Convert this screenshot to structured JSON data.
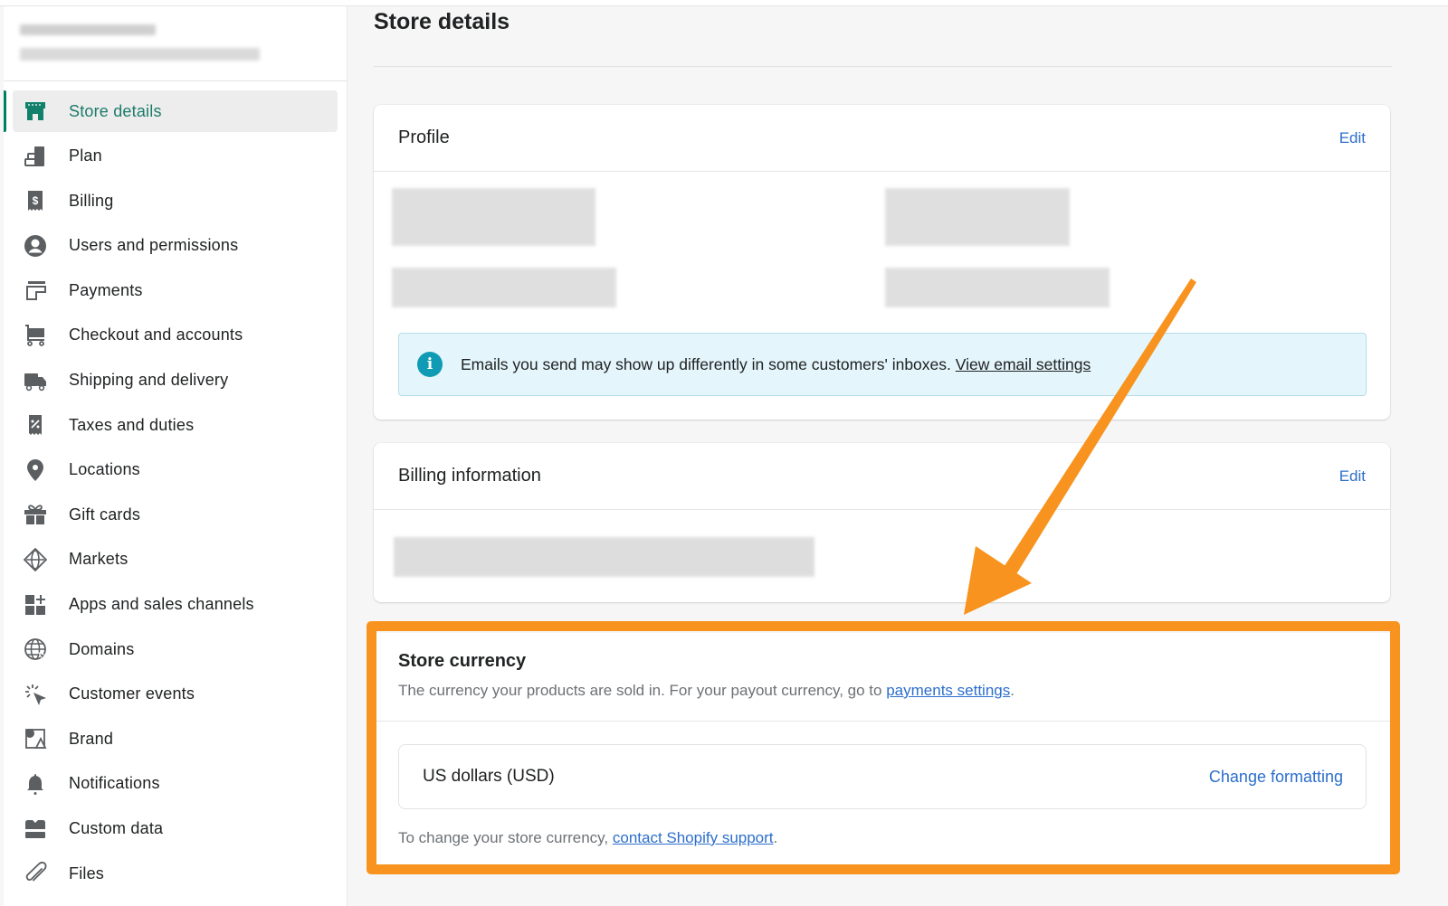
{
  "sidebar": {
    "store_name": "[blurred store name]",
    "store_url": "[blurred store url]",
    "items": [
      {
        "label": "Store details",
        "icon": "store-icon",
        "active": true
      },
      {
        "label": "Plan",
        "icon": "plan-icon"
      },
      {
        "label": "Billing",
        "icon": "billing-icon"
      },
      {
        "label": "Users and permissions",
        "icon": "user-icon"
      },
      {
        "label": "Payments",
        "icon": "payments-icon"
      },
      {
        "label": "Checkout and accounts",
        "icon": "cart-icon"
      },
      {
        "label": "Shipping and delivery",
        "icon": "truck-icon"
      },
      {
        "label": "Taxes and duties",
        "icon": "tax-icon"
      },
      {
        "label": "Locations",
        "icon": "location-pin-icon"
      },
      {
        "label": "Gift cards",
        "icon": "gift-icon"
      },
      {
        "label": "Markets",
        "icon": "globe-icon"
      },
      {
        "label": "Apps and sales channels",
        "icon": "apps-icon"
      },
      {
        "label": "Domains",
        "icon": "domain-globe-icon"
      },
      {
        "label": "Customer events",
        "icon": "cursor-click-icon"
      },
      {
        "label": "Brand",
        "icon": "brand-icon"
      },
      {
        "label": "Notifications",
        "icon": "bell-icon"
      },
      {
        "label": "Custom data",
        "icon": "custom-data-icon"
      },
      {
        "label": "Files",
        "icon": "paperclip-icon"
      }
    ]
  },
  "main": {
    "page_title": "Store details",
    "profile": {
      "title": "Profile",
      "edit_label": "Edit",
      "banner_text": "Emails you send may show up differently in some customers' inboxes.",
      "banner_link": "View email settings"
    },
    "billing": {
      "title": "Billing information",
      "edit_label": "Edit"
    },
    "currency": {
      "title": "Store currency",
      "subtitle_prefix": "The currency your products are sold in. For your payout currency, go to ",
      "subtitle_link": "payments settings",
      "subtitle_suffix": ".",
      "value": "US dollars (USD)",
      "change_label": "Change formatting",
      "footer_prefix": "To change your store currency, ",
      "footer_link": "contact Shopify support",
      "footer_suffix": "."
    }
  },
  "annotation": {
    "color": "#f7931e"
  },
  "colors": {
    "accent": "#008060",
    "link": "#2c6ecb",
    "info": "#0f9bb4"
  }
}
